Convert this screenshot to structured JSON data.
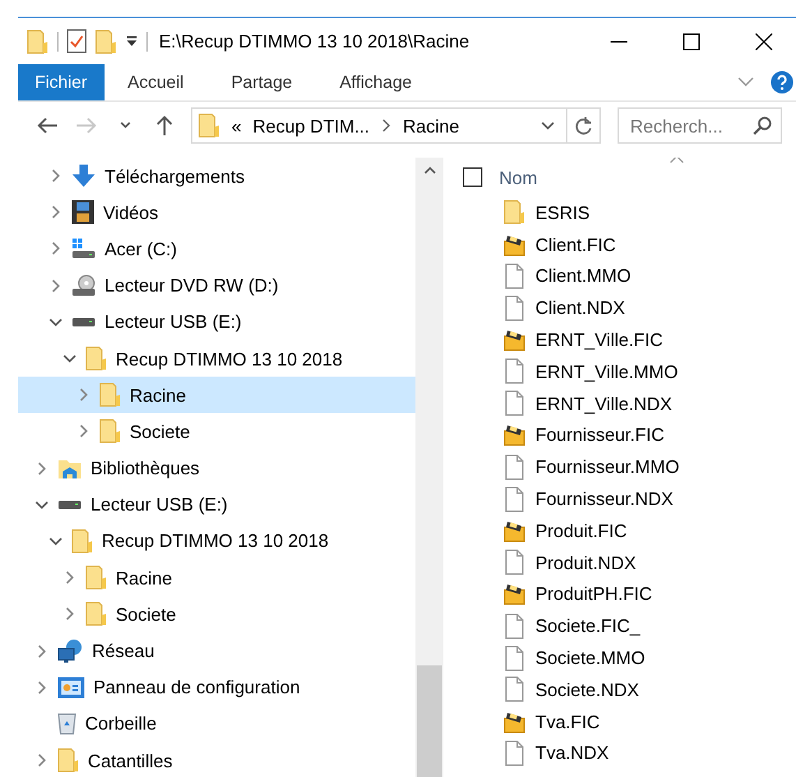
{
  "window": {
    "title": "E:\\Recup DTIMMO 13 10 2018\\Racine"
  },
  "ribbon": {
    "tabs": [
      {
        "label": "Fichier",
        "selected": true
      },
      {
        "label": "Accueil",
        "selected": false
      },
      {
        "label": "Partage",
        "selected": false
      },
      {
        "label": "Affichage",
        "selected": false
      }
    ]
  },
  "navigation_buttons": [
    {
      "kind": "back",
      "disabled": false
    },
    {
      "kind": "forward",
      "disabled": true
    },
    {
      "kind": "recent",
      "disabled": false
    },
    {
      "kind": "up",
      "disabled": false
    }
  ],
  "address_bar": {
    "overflow": "«",
    "segments": [
      "Recup DTIM...",
      "Racine"
    ]
  },
  "search": {
    "placeholder": "Recherch..."
  },
  "nav_tree": [
    {
      "children": [
        {
          "label": "Téléchargements",
          "kind": "download",
          "expandable": true,
          "expanded": false,
          "selected": false
        },
        {
          "label": "Vidéos",
          "kind": "video",
          "expandable": true,
          "expanded": false,
          "selected": false
        },
        {
          "label": "Acer (C:)",
          "kind": "system-drive",
          "expandable": true,
          "expanded": false,
          "selected": false
        },
        {
          "label": "Lecteur DVD RW (D:)",
          "kind": "dvd",
          "expandable": true,
          "expanded": false,
          "selected": false
        },
        {
          "label": "Lecteur USB (E:)",
          "kind": "drive",
          "expandable": true,
          "expanded": true,
          "selected": false,
          "children": [
            {
              "label": "Recup DTIMMO 13 10 2018",
              "kind": "folder",
              "expandable": true,
              "expanded": true,
              "selected": false,
              "children": [
                {
                  "label": "Racine",
                  "kind": "folder",
                  "expandable": true,
                  "expanded": false,
                  "selected": true
                },
                {
                  "label": "Societe",
                  "kind": "folder",
                  "expandable": true,
                  "expanded": false,
                  "selected": false
                }
              ]
            }
          ]
        }
      ]
    },
    {
      "label": "Bibliothèques",
      "kind": "library",
      "expandable": true,
      "expanded": false,
      "selected": false
    },
    {
      "label": "Lecteur USB (E:)",
      "kind": "drive",
      "expandable": true,
      "expanded": true,
      "selected": false,
      "children": [
        {
          "label": "Recup DTIMMO 13 10 2018",
          "kind": "folder",
          "expandable": true,
          "expanded": true,
          "selected": false,
          "children": [
            {
              "label": "Racine",
              "kind": "folder",
              "expandable": true,
              "expanded": false,
              "selected": false
            },
            {
              "label": "Societe",
              "kind": "folder",
              "expandable": true,
              "expanded": false,
              "selected": false
            }
          ]
        }
      ]
    },
    {
      "label": "Réseau",
      "kind": "network",
      "expandable": true,
      "expanded": false,
      "selected": false
    },
    {
      "label": "Panneau de configuration",
      "kind": "control-panel",
      "expandable": true,
      "expanded": false,
      "selected": false
    },
    {
      "label": "Corbeille",
      "kind": "recycle-bin",
      "expandable": false,
      "expanded": false,
      "selected": false
    },
    {
      "label": "Catantilles",
      "kind": "folder",
      "expandable": true,
      "expanded": false,
      "selected": false
    }
  ],
  "file_list": {
    "select_all": {
      "checked": false
    },
    "columns": [
      "Nom"
    ],
    "files": [
      {
        "name": "ESRIS",
        "kind": "folder"
      },
      {
        "name": "Client.FIC",
        "kind": "database"
      },
      {
        "name": "Client.MMO",
        "kind": "file"
      },
      {
        "name": "Client.NDX",
        "kind": "file"
      },
      {
        "name": "ERNT_Ville.FIC",
        "kind": "database"
      },
      {
        "name": "ERNT_Ville.MMO",
        "kind": "file"
      },
      {
        "name": "ERNT_Ville.NDX",
        "kind": "file"
      },
      {
        "name": "Fournisseur.FIC",
        "kind": "database"
      },
      {
        "name": "Fournisseur.MMO",
        "kind": "file"
      },
      {
        "name": "Fournisseur.NDX",
        "kind": "file"
      },
      {
        "name": "Produit.FIC",
        "kind": "database"
      },
      {
        "name": "Produit.NDX",
        "kind": "file"
      },
      {
        "name": "ProduitPH.FIC",
        "kind": "database"
      },
      {
        "name": "Societe.FIC_",
        "kind": "file"
      },
      {
        "name": "Societe.MMO",
        "kind": "file"
      },
      {
        "name": "Societe.NDX",
        "kind": "file"
      },
      {
        "name": "Tva.FIC",
        "kind": "database"
      },
      {
        "name": "Tva.NDX",
        "kind": "file"
      }
    ]
  }
}
